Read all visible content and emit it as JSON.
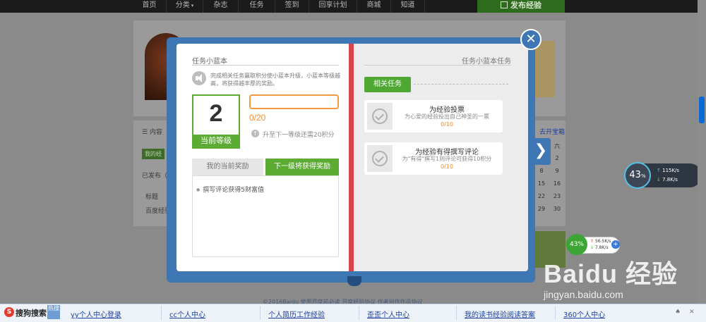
{
  "nav": {
    "items": [
      "首页",
      "分类",
      "杂志",
      "任务",
      "签到",
      "回享计划",
      "商城",
      "知道"
    ],
    "publish_label": "发布经验"
  },
  "background": {
    "section_label": "内容",
    "tab_label": "我的经",
    "published_label": "已发布（1",
    "col_label": "标题",
    "row_label": "百度经验",
    "expand_label": "去开宝箱",
    "week_label": "六",
    "days": [
      "2",
      "9",
      "16",
      "23",
      "30"
    ],
    "days_prev": [
      "",
      "8",
      "15",
      "22",
      "29"
    ],
    "footer": "©2016Baidu  使用百度前必读  百度经验协议  作者创作作品协议"
  },
  "modal": {
    "left_title": "任务小蓝本",
    "description": "完成相关任务赢取积分使小蓝本升级，小蓝本等级越高，将获得越丰厚的奖励。",
    "level_number": "2",
    "level_label": "当前等级",
    "progress": {
      "current": 0,
      "total": 20,
      "text": "0/20"
    },
    "upgrade_text": "升至下一等级还需20积分",
    "tab_current": "我的当前奖励",
    "tab_next": "下一级将获得奖励",
    "reward_item": "撰写评论获得5财富值",
    "right_title": "任务小蓝本任务",
    "related_label": "相关任务",
    "tasks": [
      {
        "title": "为经验投票",
        "desc": "为心爱的经验投出自己神圣的一票",
        "progress": "0/10"
      },
      {
        "title": "为经验有得撰写评论",
        "desc": "为\"有得\"撰写1则评论可获得10积分",
        "progress": "0/10"
      }
    ],
    "close_glyph": "✕",
    "next_glyph": "❯"
  },
  "speed_widget_1": {
    "percent": "43",
    "suffix": "%",
    "up": "115K/s",
    "down": "7.8K/s"
  },
  "speed_widget_2": {
    "percent": "43%",
    "up": "56.5K/s",
    "down": "7.8K/s"
  },
  "watermark": {
    "brand": "Baidu 经验",
    "url": "jingyan.baidu.com"
  },
  "bottombar": {
    "brand": "搜狗搜索",
    "hot": "热搜",
    "links": [
      "yy个人中心登录",
      "cc个人中心",
      "个人简历工作经验",
      "歪歪个人中心",
      "我的读书经验阅读答案",
      "360个人中心"
    ],
    "controls": [
      "♠",
      "✕"
    ]
  }
}
